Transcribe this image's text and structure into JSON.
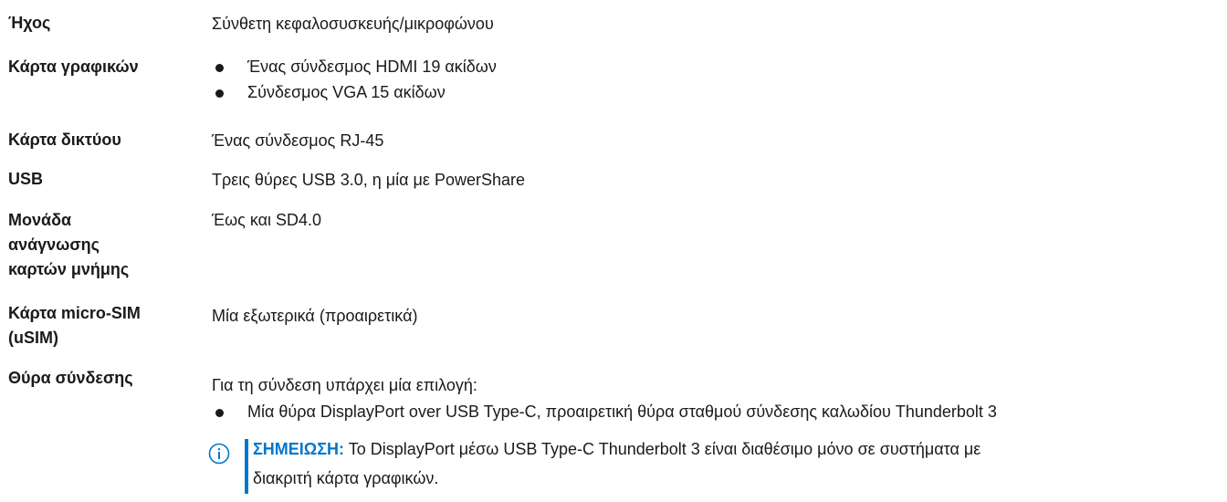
{
  "specs": {
    "audio": {
      "label": "Ήχος",
      "value": "Σύνθετη κεφαλοσυσκευής/μικροφώνου"
    },
    "graphics": {
      "label": "Κάρτα γραφικών",
      "items": [
        "Ένας σύνδεσμος HDMI 19 ακίδων",
        "Σύνδεσμος VGA 15 ακίδων"
      ]
    },
    "network": {
      "label": "Κάρτα δικτύου",
      "value": "Ένας σύνδεσμος RJ-45"
    },
    "usb": {
      "label": "USB",
      "value": "Τρεις θύρες USB 3.0, η μία με PowerShare"
    },
    "card_reader": {
      "label_lines": [
        "Μονάδα",
        "ανάγνωσης",
        "καρτών μνήμης"
      ],
      "value": "Έως και SD4.0"
    },
    "micro_sim": {
      "label_lines": [
        "Κάρτα micro-SIM",
        "(uSIM)"
      ],
      "value": "Μία εξωτερικά (προαιρετικά)"
    },
    "docking": {
      "label": "Θύρα σύνδεσης",
      "intro": "Για τη σύνδεση υπάρχει μία επιλογή:",
      "items": [
        "Μία θύρα DisplayPort over USB Type-C, προαιρετική θύρα σταθμού σύνδεσης καλωδίου Thunderbolt 3"
      ],
      "note": {
        "icon": "info-icon",
        "heading": "ΣΗΜΕΙΩΣΗ:",
        "line1": "Το DisplayPort μέσω USB Type-C Thunderbolt 3 είναι διαθέσιμο μόνο σε συστήματα με",
        "line2": "διακριτή κάρτα γραφικών."
      }
    }
  },
  "colors": {
    "text": "#1a1a1a",
    "note_accent": "#0076ce"
  }
}
